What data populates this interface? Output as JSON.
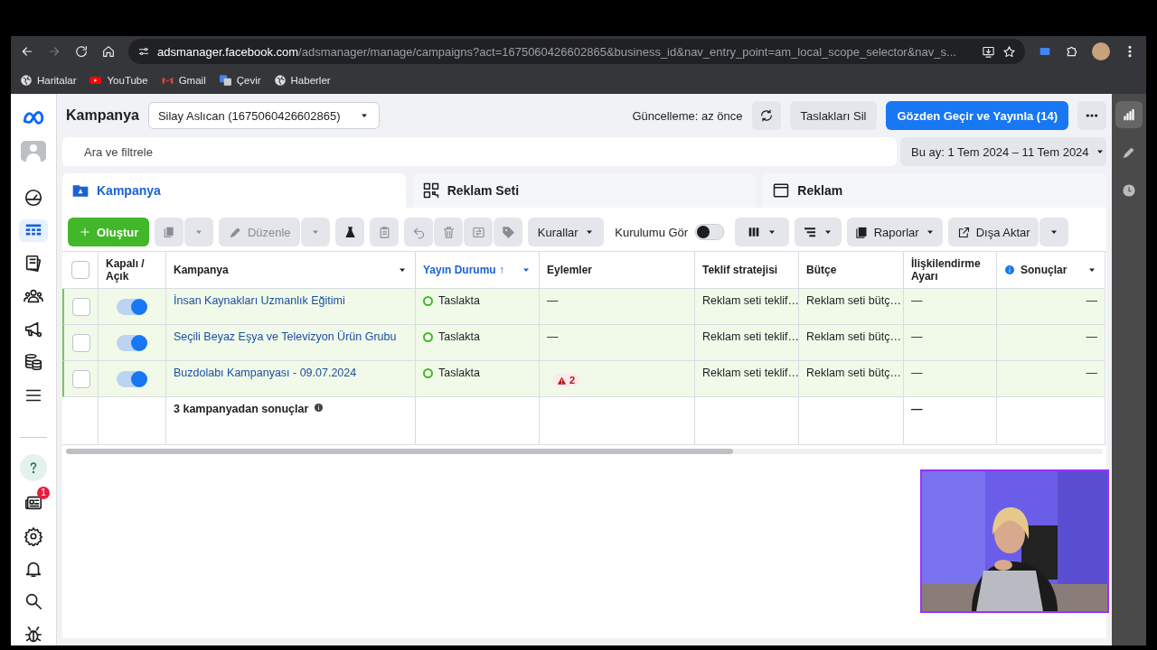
{
  "browser": {
    "url_host": "adsmanager.facebook.com",
    "url_path": "/adsmanager/manage/campaigns?act=1675060426602865&business_id&nav_entry_point=am_local_scope_selector&nav_s...",
    "bookmarks": [
      {
        "kind": "globe",
        "label": "Haritalar"
      },
      {
        "kind": "youtube",
        "label": "YouTube"
      },
      {
        "kind": "gmail",
        "label": "Gmail"
      },
      {
        "kind": "translate",
        "label": "Çevir"
      },
      {
        "kind": "globe",
        "label": "Haberler"
      }
    ]
  },
  "nav": {
    "items": [
      {
        "kind": "gauge",
        "selected": false
      },
      {
        "kind": "table",
        "selected": true
      },
      {
        "kind": "pages",
        "selected": false
      },
      {
        "kind": "people",
        "selected": false
      },
      {
        "kind": "megaphone",
        "selected": false
      },
      {
        "kind": "coins",
        "selected": false
      },
      {
        "kind": "menu",
        "selected": false
      }
    ],
    "bottom_items": [
      {
        "kind": "help"
      },
      {
        "kind": "news",
        "badge": "1"
      },
      {
        "kind": "gear"
      },
      {
        "kind": "bell"
      },
      {
        "kind": "search"
      },
      {
        "kind": "bug"
      }
    ]
  },
  "rail": {
    "items": [
      {
        "kind": "chart",
        "selected": true
      },
      {
        "kind": "pencil",
        "selected": false
      },
      {
        "kind": "clock",
        "selected": false
      }
    ]
  },
  "header": {
    "title": "Kampanya",
    "account": "Silay Aslıcan (1675060426602865)",
    "updated": "Güncelleme: az önce",
    "discard_button": "Taslakları Sil",
    "publish_button": "Gözden Geçir ve Yayınla (14)"
  },
  "search": {
    "placeholder": "Ara ve filtrele"
  },
  "date_range": "Bu ay: 1 Tem 2024 – 11 Tem 2024",
  "tabs": [
    {
      "kind": "campaign",
      "label": "Kampanya",
      "selected": true
    },
    {
      "kind": "adset",
      "label": "Reklam Seti",
      "selected": false
    },
    {
      "kind": "ad",
      "label": "Reklam",
      "selected": false
    }
  ],
  "toolbar": {
    "create": "Oluştur",
    "edit": {
      "label": "Düzenle",
      "disabled": true
    },
    "rules": "Kurallar",
    "view_setup": {
      "label": "Kurulumu Gör",
      "on": false
    },
    "reports": "Raporlar",
    "export": "Dışa Aktar"
  },
  "table": {
    "select_all_checked": false,
    "columns": [
      {
        "label": "Kapalı / Açık",
        "sorted": false,
        "menu": false,
        "info": false
      },
      {
        "label": "Kampanya",
        "sorted": false,
        "menu": true,
        "info": false
      },
      {
        "label": "Yayın Durumu ↑",
        "sorted": true,
        "menu": true,
        "info": false
      },
      {
        "label": "Eylemler",
        "sorted": false,
        "menu": false,
        "info": false
      },
      {
        "label": "Teklif stratejisi",
        "sorted": false,
        "menu": false,
        "info": false
      },
      {
        "label": "Bütçe",
        "sorted": false,
        "menu": false,
        "info": false
      },
      {
        "label": "İlişkilendirme Ayarı",
        "sorted": false,
        "menu": false,
        "info": false
      },
      {
        "label": "Sonuçlar",
        "sorted": false,
        "menu": true,
        "info": true
      }
    ],
    "rows": [
      {
        "checked": false,
        "on": true,
        "name": "İnsan Kaynakları Uzmanlık Eğitimi",
        "status": "Taslakta",
        "actions": "—",
        "bid": "Reklam seti teklif…",
        "budget": "Reklam seti bütç…",
        "attribution": "—",
        "results": "—"
      },
      {
        "checked": false,
        "on": true,
        "name": "Seçili Beyaz Eşya ve Televizyon Ürün Grubu",
        "status": "Taslakta",
        "actions": "—",
        "bid": "Reklam seti teklif…",
        "budget": "Reklam seti bütç…",
        "attribution": "—",
        "results": "—"
      },
      {
        "checked": false,
        "on": true,
        "name": "Buzdolabı Kampanyası - 09.07.2024",
        "status": "Taslakta",
        "warnings": "2",
        "bid": "Reklam seti teklif…",
        "budget": "Reklam seti bütç…",
        "attribution": "—",
        "results": "—"
      }
    ],
    "summary": {
      "label": "3 kampanyadan sonuçlar",
      "attribution": "—"
    }
  }
}
